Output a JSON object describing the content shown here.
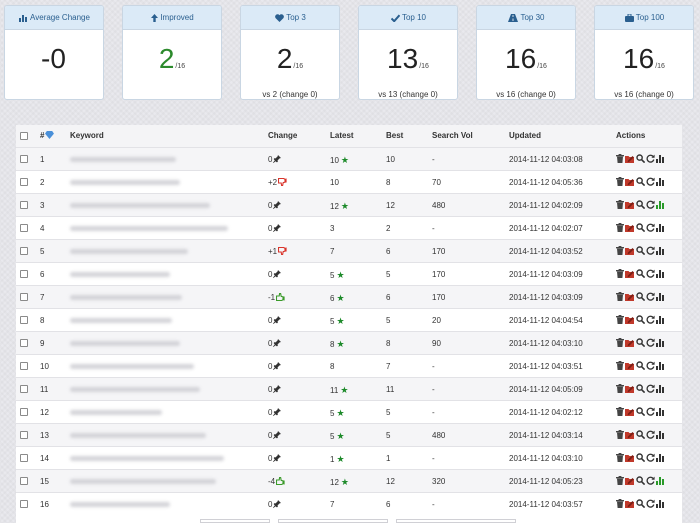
{
  "cards": [
    {
      "title": "Average Change",
      "icon": "bar-chart-icon",
      "value": "-0",
      "denominator": "",
      "sub": "",
      "color": "#222222"
    },
    {
      "title": "Improved",
      "icon": "arrow-up-icon",
      "value": "2",
      "denominator": "/16",
      "sub": "",
      "color": "#2c8a2c"
    },
    {
      "title": "Top 3",
      "icon": "heart-icon",
      "value": "2",
      "denominator": "/16",
      "sub": "vs 2 (change 0)",
      "color": "#222222"
    },
    {
      "title": "Top 10",
      "icon": "checkmark-icon",
      "value": "13",
      "denominator": "/16",
      "sub": "vs 13 (change 0)",
      "color": "#222222"
    },
    {
      "title": "Top 30",
      "icon": "road-icon",
      "value": "16",
      "denominator": "/16",
      "sub": "vs 16 (change 0)",
      "color": "#222222"
    },
    {
      "title": "Top 100",
      "icon": "briefcase-icon",
      "value": "16",
      "denominator": "/16",
      "sub": "vs 16 (change 0)",
      "color": "#222222"
    }
  ],
  "table": {
    "headers": {
      "num": "#",
      "keyword": "Keyword",
      "change": "Change",
      "latest": "Latest",
      "best": "Best",
      "search_vol": "Search Vol",
      "updated": "Updated",
      "actions": "Actions"
    },
    "rows": [
      {
        "num": "1",
        "change": "0",
        "change_icon": "pin-icon",
        "latest": "10",
        "star": true,
        "best": "10",
        "search_vol": "-",
        "updated": "2014-11-12 04:03:08",
        "chart_green": false
      },
      {
        "num": "2",
        "change": "+2",
        "change_icon": "thumbs-down-icon",
        "latest": "10",
        "star": false,
        "best": "8",
        "search_vol": "70",
        "updated": "2014-11-12 04:05:36",
        "chart_green": false
      },
      {
        "num": "3",
        "change": "0",
        "change_icon": "pin-icon",
        "latest": "12",
        "star": true,
        "best": "12",
        "search_vol": "480",
        "updated": "2014-11-12 04:02:09",
        "chart_green": true
      },
      {
        "num": "4",
        "change": "0",
        "change_icon": "pin-icon",
        "latest": "3",
        "star": false,
        "best": "2",
        "search_vol": "-",
        "updated": "2014-11-12 04:02:07",
        "chart_green": false
      },
      {
        "num": "5",
        "change": "+1",
        "change_icon": "thumbs-down-icon",
        "latest": "7",
        "star": false,
        "best": "6",
        "search_vol": "170",
        "updated": "2014-11-12 04:03:52",
        "chart_green": false
      },
      {
        "num": "6",
        "change": "0",
        "change_icon": "pin-icon",
        "latest": "5",
        "star": true,
        "best": "5",
        "search_vol": "170",
        "updated": "2014-11-12 04:03:09",
        "chart_green": false
      },
      {
        "num": "7",
        "change": "-1",
        "change_icon": "thumbs-up-icon",
        "latest": "6",
        "star": true,
        "best": "6",
        "search_vol": "170",
        "updated": "2014-11-12 04:03:09",
        "chart_green": false
      },
      {
        "num": "8",
        "change": "0",
        "change_icon": "pin-icon",
        "latest": "5",
        "star": true,
        "best": "5",
        "search_vol": "20",
        "updated": "2014-11-12 04:04:54",
        "chart_green": false
      },
      {
        "num": "9",
        "change": "0",
        "change_icon": "pin-icon",
        "latest": "8",
        "star": true,
        "best": "8",
        "search_vol": "90",
        "updated": "2014-11-12 04:03:10",
        "chart_green": false
      },
      {
        "num": "10",
        "change": "0",
        "change_icon": "pin-icon",
        "latest": "8",
        "star": false,
        "best": "7",
        "search_vol": "-",
        "updated": "2014-11-12 04:03:51",
        "chart_green": false
      },
      {
        "num": "11",
        "change": "0",
        "change_icon": "pin-icon",
        "latest": "11",
        "star": true,
        "best": "11",
        "search_vol": "-",
        "updated": "2014-11-12 04:05:09",
        "chart_green": false
      },
      {
        "num": "12",
        "change": "0",
        "change_icon": "pin-icon",
        "latest": "5",
        "star": true,
        "best": "5",
        "search_vol": "-",
        "updated": "2014-11-12 04:02:12",
        "chart_green": false
      },
      {
        "num": "13",
        "change": "0",
        "change_icon": "pin-icon",
        "latest": "5",
        "star": true,
        "best": "5",
        "search_vol": "480",
        "updated": "2014-11-12 04:03:14",
        "chart_green": false
      },
      {
        "num": "14",
        "change": "0",
        "change_icon": "pin-icon",
        "latest": "1",
        "star": true,
        "best": "1",
        "search_vol": "-",
        "updated": "2014-11-12 04:03:10",
        "chart_green": false
      },
      {
        "num": "15",
        "change": "-4",
        "change_icon": "thumbs-up-icon",
        "latest": "12",
        "star": true,
        "best": "12",
        "search_vol": "320",
        "updated": "2014-11-12 04:05:23",
        "chart_green": true
      },
      {
        "num": "16",
        "change": "0",
        "change_icon": "pin-icon",
        "latest": "7",
        "star": false,
        "best": "6",
        "search_vol": "-",
        "updated": "2014-11-12 04:03:57",
        "chart_green": false
      }
    ]
  },
  "colors": {
    "card_header_bg": "#dbeaf7",
    "card_header_text": "#2a5f8f",
    "improved_green": "#2c8a2c",
    "star_green": "#1d8a2a",
    "thumbs_down_red": "#d9342b",
    "thumbs_up_green": "#3a9a2a"
  }
}
